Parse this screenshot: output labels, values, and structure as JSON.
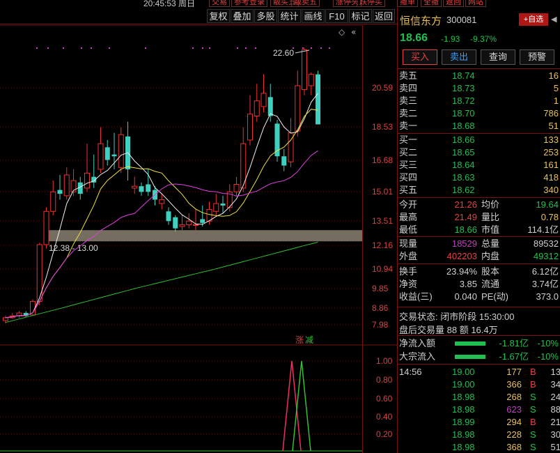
{
  "top": {
    "clock": "20:45:53 周日",
    "buttons": [
      "交易",
      "参考登录",
      "靓买五",
      "靓卖五",
      "涨停头",
      "跌停买",
      "撤单",
      "全撤",
      "返回",
      "网站"
    ]
  },
  "toolbar": [
    "复权",
    "叠加",
    "多股",
    "统计",
    "画线",
    "F10",
    "标记",
    "返回"
  ],
  "stock": {
    "name": "恒信东方",
    "code": "300081",
    "add_fav": "+自选",
    "price": "18.66",
    "change": "-1.93",
    "pct": "-9.37%",
    "buttons": {
      "buy": "买入",
      "sell": "卖出",
      "query": "查询",
      "alert": "预警"
    }
  },
  "orderbook": {
    "asks": [
      {
        "label": "卖五",
        "price": "18.74",
        "vol": "16"
      },
      {
        "label": "卖四",
        "price": "18.73",
        "vol": "5"
      },
      {
        "label": "卖三",
        "price": "18.72",
        "vol": "1"
      },
      {
        "label": "卖二",
        "price": "18.70",
        "vol": "786"
      },
      {
        "label": "卖一",
        "price": "18.68",
        "vol": "51"
      }
    ],
    "bids": [
      {
        "label": "买一",
        "price": "18.66",
        "vol": "133"
      },
      {
        "label": "买二",
        "price": "18.65",
        "vol": "253"
      },
      {
        "label": "买三",
        "price": "18.64",
        "vol": "161"
      },
      {
        "label": "买四",
        "price": "18.63",
        "vol": "418"
      },
      {
        "label": "买五",
        "price": "18.62",
        "vol": "340"
      }
    ]
  },
  "stats": [
    {
      "l1": "今开",
      "v1": "21.26",
      "c1": "#e84040",
      "l2": "均价",
      "v2": "19.64",
      "c2": "#20c050"
    },
    {
      "l1": "最高",
      "v1": "21.49",
      "c1": "#e84040",
      "l2": "量比",
      "v2": "0.78",
      "c2": "#e8c060"
    },
    {
      "l1": "最低",
      "v1": "18.66",
      "c1": "#20c050",
      "l2": "市值",
      "v2": "114.1亿",
      "c2": "#d0d0d0"
    },
    {
      "l1": "现量",
      "v1": "18529",
      "c1": "#c040c0",
      "l2": "总量",
      "v2": "89532",
      "c2": "#d0d0d0"
    },
    {
      "l1": "外盘",
      "v1": "402203",
      "c1": "#e84040",
      "l2": "内盘",
      "v2": "49312",
      "c2": "#20c050"
    },
    {
      "l1": "换手",
      "v1": "23.94%",
      "c1": "#d0d0d0",
      "l2": "股本",
      "v2": "6.12亿",
      "c2": "#d0d0d0"
    },
    {
      "l1": "净资",
      "v1": "3.85",
      "c1": "#d0d0d0",
      "l2": "流通",
      "v2": "3.74亿",
      "c2": "#d0d0d0"
    },
    {
      "l1": "收益(三)",
      "v1": "0.040",
      "c1": "#d0d0d0",
      "l2": "PE(动)",
      "v2": "373.0",
      "c2": "#d0d0d0"
    }
  ],
  "info": {
    "status_label": "交易状态:",
    "status_value": "闭市阶段 15:30:00",
    "after_label": "盘后交易量",
    "after_value": "88 额 16.4万"
  },
  "flow": [
    {
      "label": "净流入额",
      "val": "-1.81亿",
      "pct": "-10%"
    },
    {
      "label": "大宗流入",
      "val": "-1.67亿",
      "pct": "-10%"
    }
  ],
  "ticks": [
    {
      "time": "14:56",
      "price": "19.00",
      "vol": "177",
      "volc": "#e8c060",
      "side": "B",
      "n": "13"
    },
    {
      "time": "",
      "price": "19.00",
      "vol": "366",
      "volc": "#e8c060",
      "side": "B",
      "n": "34"
    },
    {
      "time": "",
      "price": "18.98",
      "vol": "268",
      "volc": "#e8c060",
      "side": "S",
      "n": "24"
    },
    {
      "time": "",
      "price": "18.98",
      "vol": "623",
      "volc": "#c040c0",
      "side": "S",
      "n": "88"
    },
    {
      "time": "",
      "price": "18.99",
      "vol": "294",
      "volc": "#e8c060",
      "side": "B",
      "n": "21"
    },
    {
      "time": "",
      "price": "18.98",
      "vol": "228",
      "volc": "#e8c060",
      "side": "S",
      "n": "30"
    },
    {
      "time": "",
      "price": "18.98",
      "vol": "368",
      "volc": "#e8c060",
      "side": "S",
      "n": "51"
    }
  ],
  "chart": {
    "price_axis": [
      "20.59",
      "18.53",
      "16.68",
      "15.01",
      "13.51",
      "12.16",
      "10.94",
      "9.85",
      "8.86",
      "7.98"
    ],
    "high_label": "22.60",
    "zone_label": "12.38 - 13.00",
    "ind_axis": [
      "1.00",
      "0.80",
      "0.60",
      "0.40",
      "0.20"
    ],
    "zhang": "涨",
    "jian": "减",
    "diamond": "◇",
    "collapse": "«",
    "candles": [
      [
        8.2,
        8.35,
        8.05,
        8.45
      ],
      [
        8.35,
        8.45,
        8.3,
        8.6
      ],
      [
        8.45,
        8.6,
        8.35,
        8.7
      ],
      [
        8.6,
        8.45,
        8.4,
        8.7
      ],
      [
        8.5,
        9.2,
        8.45,
        9.3
      ],
      [
        9.2,
        12.2,
        9.0,
        12.3
      ],
      [
        12.2,
        14.0,
        12.0,
        14.2
      ],
      [
        14.0,
        15.0,
        13.8,
        15.6
      ],
      [
        15.1,
        14.9,
        14.6,
        15.9
      ],
      [
        14.8,
        15.9,
        14.6,
        16.3
      ],
      [
        15.0,
        15.6,
        14.8,
        16.2
      ],
      [
        15.5,
        14.9,
        14.6,
        15.8
      ],
      [
        15.2,
        16.0,
        15.0,
        17.6
      ],
      [
        15.8,
        15.5,
        15.2,
        17.0
      ],
      [
        16.2,
        17.6,
        16.0,
        18.5
      ],
      [
        17.4,
        16.7,
        16.4,
        17.8
      ],
      [
        17.0,
        16.9,
        16.2,
        18.2
      ],
      [
        16.3,
        18.1,
        16.0,
        18.5
      ],
      [
        18.0,
        16.2,
        15.6,
        18.8
      ],
      [
        15.2,
        15.3,
        14.9,
        15.8
      ],
      [
        15.3,
        15.0,
        14.8,
        15.5
      ],
      [
        15.4,
        15.0,
        14.8,
        16.2
      ],
      [
        15.1,
        14.6,
        14.3,
        15.3
      ],
      [
        14.4,
        14.6,
        14.1,
        14.9
      ],
      [
        14.0,
        13.5,
        13.3,
        14.2
      ],
      [
        13.7,
        13.1,
        12.9,
        13.8
      ],
      [
        13.2,
        13.3,
        13.0,
        13.8
      ],
      [
        13.3,
        13.5,
        13.1,
        13.9
      ],
      [
        13.3,
        13.3,
        13.0,
        14.1
      ],
      [
        13.6,
        13.4,
        13.2,
        14.3
      ],
      [
        13.5,
        14.1,
        13.3,
        14.5
      ],
      [
        14.0,
        14.4,
        13.8,
        14.9
      ],
      [
        14.4,
        14.3,
        13.9,
        14.8
      ],
      [
        14.2,
        15.0,
        14.0,
        15.4
      ],
      [
        15.0,
        15.4,
        14.8,
        15.8
      ],
      [
        15.2,
        17.6,
        15.0,
        18.5
      ],
      [
        17.8,
        19.2,
        17.5,
        20.2
      ],
      [
        19.1,
        19.9,
        18.8,
        20.8
      ],
      [
        19.6,
        20.3,
        19.3,
        21.3
      ],
      [
        20.1,
        19.1,
        18.8,
        20.8
      ],
      [
        18.7,
        16.9,
        16.6,
        18.9
      ],
      [
        16.9,
        16.4,
        16.1,
        17.3
      ],
      [
        16.6,
        18.2,
        16.3,
        19.0
      ],
      [
        18.3,
        20.7,
        18.0,
        21.5
      ],
      [
        20.5,
        22.6,
        20.2,
        22.7
      ],
      [
        20.7,
        21.3,
        20.2,
        21.4
      ],
      [
        21.3,
        18.66,
        18.66,
        21.49
      ]
    ]
  }
}
